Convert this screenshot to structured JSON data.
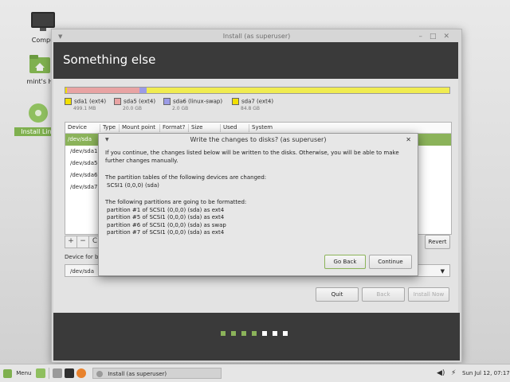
{
  "desktop": {
    "icons": [
      {
        "label": "Compu"
      },
      {
        "label": "mint's H"
      },
      {
        "label": "Install Linu"
      }
    ]
  },
  "window": {
    "title": "Install (as superuser)",
    "header": "Something else",
    "legend": [
      {
        "name": "sda1 (ext4)",
        "size": "499.1 MB",
        "color": "#f2e000"
      },
      {
        "name": "sda5 (ext4)",
        "size": "20.0 GB",
        "color": "#e8a3a3"
      },
      {
        "name": "sda6 (linux-swap)",
        "size": "2.0 GB",
        "color": "#9b9be6"
      },
      {
        "name": "sda7 (ext4)",
        "size": "84.8 GB",
        "color": "#f2e000"
      }
    ],
    "table": {
      "headers": [
        "Device",
        "Type",
        "Mount point",
        "Format?",
        "Size",
        "Used",
        "System"
      ],
      "rows": [
        "/dev/sda",
        "/dev/sda1",
        "/dev/sda5",
        "/dev/sda6",
        "/dev/sda7"
      ]
    },
    "toolbar": {
      "add": "+",
      "remove": "−",
      "change": "C",
      "revert": "Revert"
    },
    "device_label": "Device for b",
    "device_value": "/dev/sda",
    "buttons": {
      "quit": "Quit",
      "back": "Back",
      "install": "Install Now"
    }
  },
  "dialog": {
    "title": "Write the changes to disks? (as superuser)",
    "intro": "If you continue, the changes listed below will be written to the disks. Otherwise, you will be able to make further changes manually.",
    "tables_heading": "The partition tables of the following devices are changed:",
    "tables_items": [
      "SCSI1 (0,0,0) (sda)"
    ],
    "format_heading": "The following partitions are going to be formatted:",
    "format_items": [
      "partition #1 of SCSI1 (0,0,0) (sda) as ext4",
      "partition #5 of SCSI1 (0,0,0) (sda) as ext4",
      "partition #6 of SCSI1 (0,0,0) (sda) as swap",
      "partition #7 of SCSI1 (0,0,0) (sda) as ext4"
    ],
    "go_back": "Go Back",
    "continue": "Continue"
  },
  "taskbar": {
    "menu": "Menu",
    "task": "Install (as superuser)",
    "clock": "Sun Jul 12, 07:17"
  },
  "progress": {
    "done_steps": 4,
    "total_steps": 7
  }
}
